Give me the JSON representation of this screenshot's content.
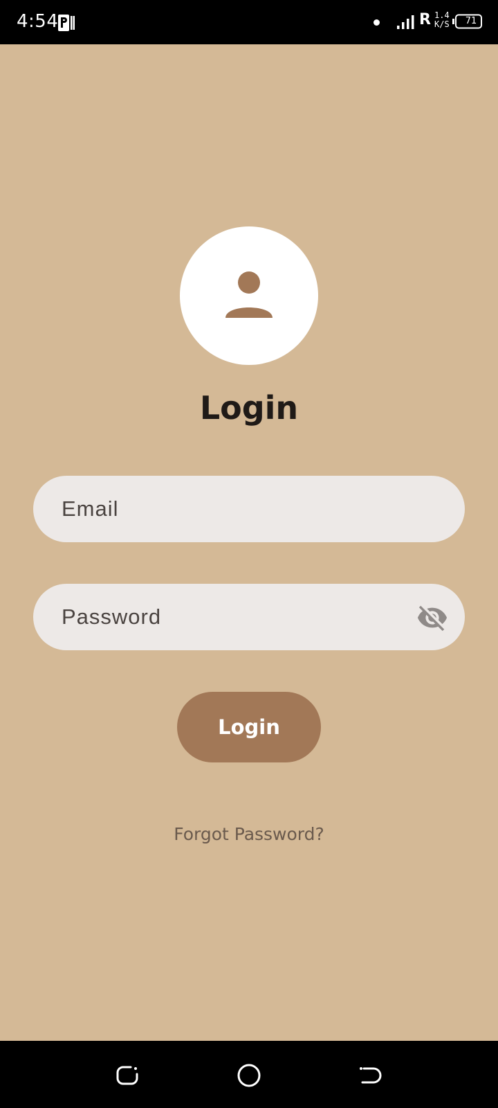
{
  "status_bar": {
    "time": "4:54",
    "app_icon": "parking-app-icon",
    "roaming": "R",
    "net_speed_value": "1.4",
    "net_speed_unit": "K/S",
    "battery_level": "71"
  },
  "login": {
    "avatar_icon": "person-icon",
    "title": "Login",
    "email_placeholder": "Email",
    "password_placeholder": "Password",
    "password_toggle_icon": "visibility-off-icon",
    "login_button_label": "Login",
    "forgot_password_label": "Forgot Password?"
  },
  "nav_bar": {
    "recents_icon": "recents-icon",
    "home_icon": "home-icon",
    "back_icon": "back-icon"
  },
  "colors": {
    "background": "#D4B996",
    "accent": "#A27857",
    "field_background": "#EDE9E7",
    "title_text": "#1F1A17",
    "link_text": "#6A5A4D"
  }
}
